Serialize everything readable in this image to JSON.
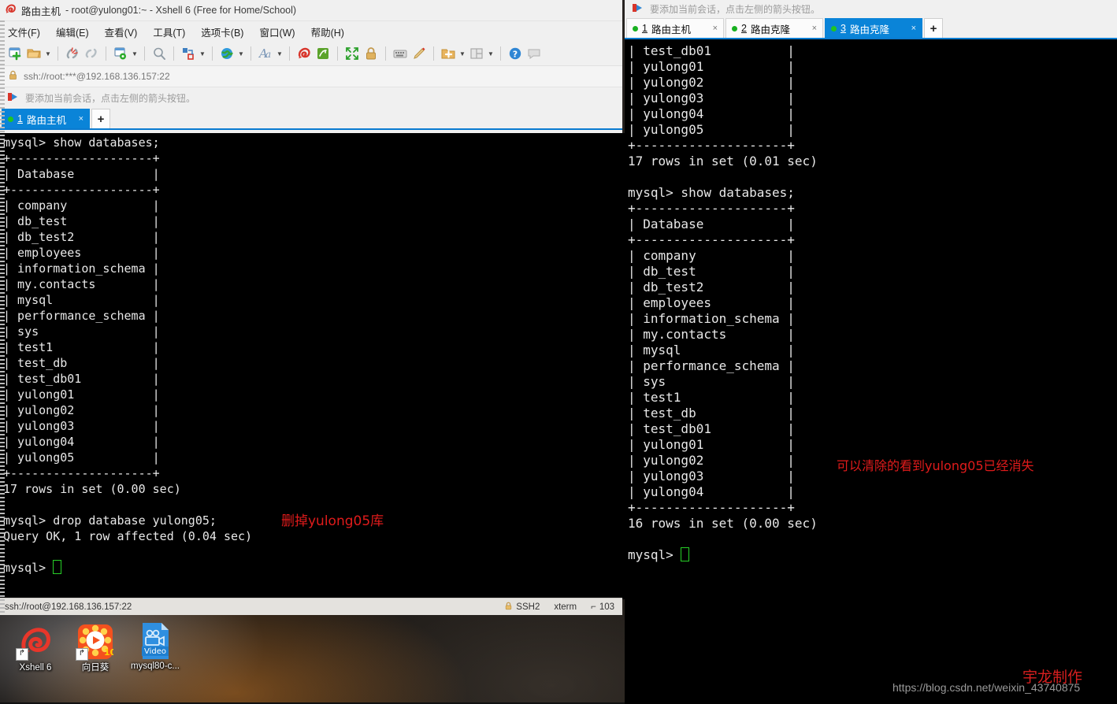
{
  "desktop": {
    "icons": [
      {
        "label": "Xshell 6",
        "icon": "xshell-app-icon"
      },
      {
        "label": "向日葵",
        "icon": "sunflower-app-icon"
      },
      {
        "label": "mysql80-c...",
        "icon": "video-file-icon"
      }
    ]
  },
  "left_window": {
    "title_app": "路由主机",
    "title_rest": "- root@yulong01:~ - Xshell 6 (Free for Home/School)",
    "menu": [
      "文件(F)",
      "编辑(E)",
      "查看(V)",
      "工具(T)",
      "选项卡(B)",
      "窗口(W)",
      "帮助(H)"
    ],
    "toolbar_icons": [
      "new-session-icon",
      "open-folder-icon",
      "open-dropdown-caret",
      "disconnect-icon",
      "link-icon",
      "session-properties-icon",
      "properties-dropdown-caret",
      "find-icon",
      "transfer-icon",
      "transfer-dropdown-caret",
      "globe-icon",
      "globe-dropdown-caret",
      "font-icon",
      "font-dropdown-caret",
      "xshell-icon",
      "xftp-icon",
      "fullscreen-icon",
      "lock-icon",
      "keyboard-icon",
      "highlight-pen-icon",
      "add-folder-icon",
      "add-folder-dropdown-caret",
      "layout-icon",
      "layout-dropdown-caret",
      "help-icon",
      "comment-icon"
    ],
    "address": "ssh://root:***@192.168.136.157:22",
    "notice": "要添加当前会话，点击左侧的箭头按钮。",
    "tabs": [
      {
        "num": "1",
        "label": "路由主机",
        "active": true
      }
    ],
    "tab_add_label": "+",
    "terminal_lines": [
      "mysql> show databases;",
      "+--------------------+",
      "| Database           |",
      "+--------------------+",
      "| company            |",
      "| db_test            |",
      "| db_test2           |",
      "| employees          |",
      "| information_schema |",
      "| my.contacts        |",
      "| mysql              |",
      "| performance_schema |",
      "| sys                |",
      "| test1              |",
      "| test_db            |",
      "| test_db01          |",
      "| yulong01           |",
      "| yulong02           |",
      "| yulong03           |",
      "| yulong04           |",
      "| yulong05           |",
      "+--------------------+",
      "17 rows in set (0.00 sec)",
      "",
      "mysql> drop database yulong05;",
      "Query OK, 1 row affected (0.04 sec)",
      "",
      "mysql> "
    ],
    "annotation": "删掉yulong05库",
    "status": {
      "left": "ssh://root@192.168.136.157:22",
      "ssh": "SSH2",
      "term": "xterm",
      "size": "103"
    }
  },
  "right_window": {
    "notice": "要添加当前会话，点击左侧的箭头按钮。",
    "tabs": [
      {
        "num": "1",
        "label": "路由主机",
        "active": false
      },
      {
        "num": "2",
        "label": "路由克隆",
        "active": false
      },
      {
        "num": "3",
        "label": "路由克隆",
        "active": true
      }
    ],
    "tab_add_label": "+",
    "terminal_lines": [
      "| test_db01          |",
      "| yulong01           |",
      "| yulong02           |",
      "| yulong03           |",
      "| yulong04           |",
      "| yulong05           |",
      "+--------------------+",
      "17 rows in set (0.01 sec)",
      "",
      "mysql> show databases;",
      "+--------------------+",
      "| Database           |",
      "+--------------------+",
      "| company            |",
      "| db_test            |",
      "| db_test2           |",
      "| employees          |",
      "| information_schema |",
      "| my.contacts        |",
      "| mysql              |",
      "| performance_schema |",
      "| sys                |",
      "| test1              |",
      "| test_db            |",
      "| test_db01          |",
      "| yulong01           |",
      "| yulong02           |",
      "| yulong03           |",
      "| yulong04           |",
      "+--------------------+",
      "16 rows in set (0.00 sec)",
      "",
      "mysql> "
    ],
    "annotation": "可以清除的看到yulong05已经消失"
  },
  "watermarks": {
    "url": "https://blog.csdn.net/weixin_43740875",
    "author": "宇龙制作"
  },
  "colors": {
    "accent_tab": "#0a84d8",
    "terminal_bg": "#000000",
    "terminal_fg": "#e8e8e8",
    "annotation_red": "#e01b1b",
    "cursor_green": "#27d027"
  }
}
